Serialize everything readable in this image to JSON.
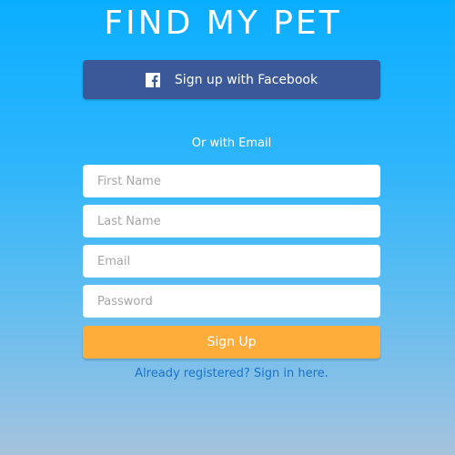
{
  "app": {
    "title": "FIND MY PET"
  },
  "facebook": {
    "label": "Sign up with Facebook",
    "icon": "facebook-icon",
    "color": "#3b5998"
  },
  "divider_text": "Or with Email",
  "form": {
    "first_name_placeholder": "First Name",
    "last_name_placeholder": "Last Name",
    "email_placeholder": "Email",
    "password_placeholder": "Password",
    "first_name_value": "",
    "last_name_value": "",
    "email_value": "",
    "password_value": ""
  },
  "signup": {
    "label": "Sign Up",
    "color": "#ffad3a"
  },
  "signin_link": "Already registered? Sign in here.",
  "colors": {
    "background_top": "#0aaeff",
    "background_bottom": "#a6c3dc",
    "link": "#1a73c8"
  }
}
